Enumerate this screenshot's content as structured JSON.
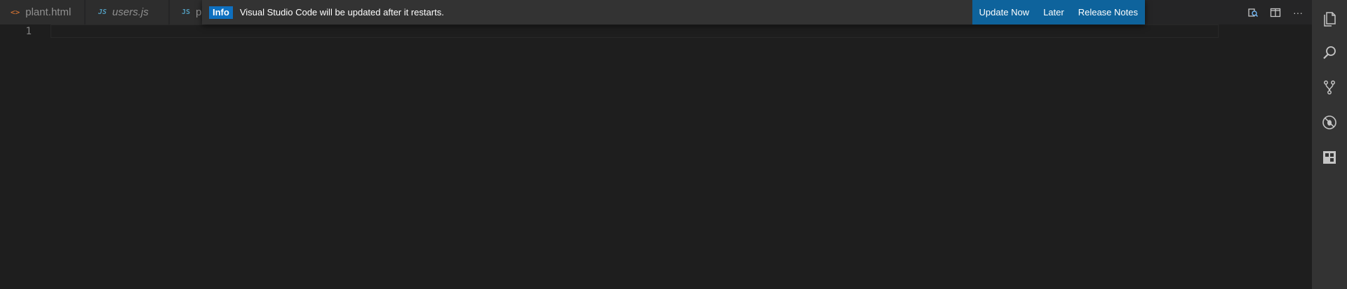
{
  "tabs": [
    {
      "label": "plant.html",
      "icon": "<>"
    },
    {
      "label": "users.js",
      "icon": "JS"
    },
    {
      "label": "pl",
      "icon": "JS"
    }
  ],
  "editor": {
    "line_number": "1"
  },
  "notification": {
    "severity": "Info",
    "message": "Visual Studio Code will be updated after it restarts.",
    "actions": {
      "update_now": "Update Now",
      "later": "Later",
      "release_notes": "Release Notes"
    }
  },
  "editor_actions": {
    "more": "···"
  },
  "activitybar": [
    "files-icon",
    "search-icon",
    "source-control-icon",
    "debug-icon",
    "extensions-icon"
  ],
  "colors": {
    "badge": "#0e70c0",
    "action_bg": "#0e639c",
    "editor_bg": "#1e1e1e"
  }
}
